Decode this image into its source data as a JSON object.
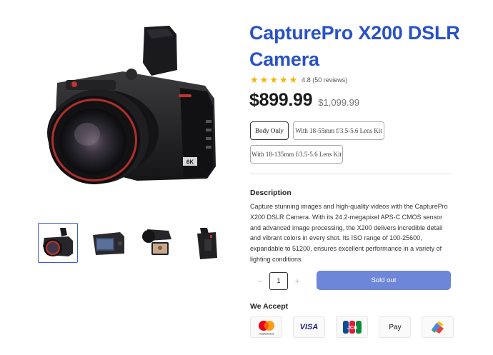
{
  "product": {
    "title": "CapturePro X200 DSLR Camera",
    "rating_text": "4.8 (50 reviews)",
    "rating_value": 4.8,
    "stars": 5,
    "price": "$899.99",
    "compare_price": "$1,099.99"
  },
  "variants": [
    {
      "label": "Body Only",
      "selected": true
    },
    {
      "label": "With 18-55mm f/3.5-5.6 Lens Kit",
      "selected": false
    },
    {
      "label": "With 18-135mm f/3.5-5.6 Lens Kit",
      "selected": false
    }
  ],
  "description": {
    "heading": "Description",
    "text": "Capture stunning images and high-quality videos with the CapturePro X200 DSLR Camera. With its 24.2-megapixel APS-C CMOS sensor and advanced image processing, the X200 delivers incredible detail and vibrant colors in every shot. Its ISO range of 100-25600, expandable to 51200, ensures excellent performance in a variety of lighting conditions."
  },
  "purchase": {
    "quantity": "1",
    "minus": "−",
    "plus": "+",
    "button_label": "Sold out"
  },
  "payments": {
    "heading": "We Accept",
    "methods": [
      {
        "icon": "mastercard-icon",
        "label": "mastercard"
      },
      {
        "icon": "visa-icon",
        "label": "VISA"
      },
      {
        "icon": "jcb-icon",
        "label": "JCB"
      },
      {
        "icon": "apple-pay-icon",
        "label": "Pay"
      },
      {
        "icon": "google-pay-icon",
        "label": ""
      }
    ]
  },
  "gallery": {
    "selected_index": 0,
    "thumbs": [
      "camera-front",
      "camera-back",
      "camera-flip-screen",
      "camera-side"
    ]
  },
  "colors": {
    "accent": "#2952c8",
    "button": "#6d86d8",
    "star": "#f5b301"
  }
}
